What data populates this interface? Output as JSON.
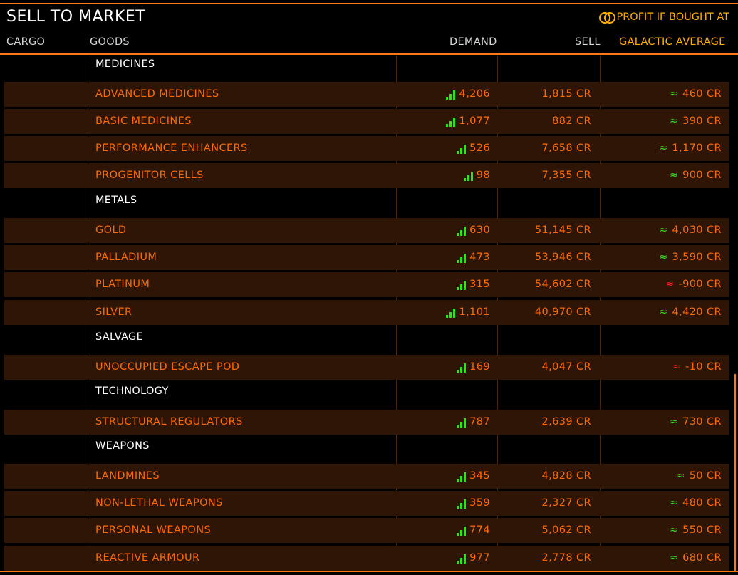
{
  "header": {
    "title": "SELL TO MARKET",
    "profit_note": "PROFIT IF BOUGHT AT",
    "profit_icon": "linked-rings-icon"
  },
  "columns": {
    "cargo": "CARGO",
    "goods": "GOODS",
    "demand": "DEMAND",
    "sell": "SELL",
    "galactic_average": "GALACTIC AVERAGE"
  },
  "colors": {
    "accent": "#ff7a14",
    "gold": "#ffae00",
    "row_bg": "#2e1505",
    "positive": "#32e61e",
    "negative": "#ff2020"
  },
  "categories": [
    {
      "name": "MEDICINES",
      "items": [
        {
          "name": "ADVANCED MEDICINES",
          "demand": "4,206",
          "sell": "1,815 CR",
          "profit": "460 CR",
          "profit_sign": "positive"
        },
        {
          "name": "BASIC MEDICINES",
          "demand": "1,077",
          "sell": "882 CR",
          "profit": "390 CR",
          "profit_sign": "positive"
        },
        {
          "name": "PERFORMANCE ENHANCERS",
          "demand": "526",
          "sell": "7,658 CR",
          "profit": "1,170 CR",
          "profit_sign": "positive"
        },
        {
          "name": "PROGENITOR CELLS",
          "demand": "98",
          "sell": "7,355 CR",
          "profit": "900 CR",
          "profit_sign": "positive"
        }
      ]
    },
    {
      "name": "METALS",
      "items": [
        {
          "name": "GOLD",
          "demand": "630",
          "sell": "51,145 CR",
          "profit": "4,030 CR",
          "profit_sign": "positive"
        },
        {
          "name": "PALLADIUM",
          "demand": "473",
          "sell": "53,946 CR",
          "profit": "3,590 CR",
          "profit_sign": "positive"
        },
        {
          "name": "PLATINUM",
          "demand": "315",
          "sell": "54,602 CR",
          "profit": "-900 CR",
          "profit_sign": "negative"
        },
        {
          "name": "SILVER",
          "demand": "1,101",
          "sell": "40,970 CR",
          "profit": "4,420 CR",
          "profit_sign": "positive"
        }
      ]
    },
    {
      "name": "SALVAGE",
      "items": [
        {
          "name": "UNOCCUPIED ESCAPE POD",
          "demand": "169",
          "sell": "4,047 CR",
          "profit": "-10 CR",
          "profit_sign": "negative"
        }
      ]
    },
    {
      "name": "TECHNOLOGY",
      "items": [
        {
          "name": "STRUCTURAL REGULATORS",
          "demand": "787",
          "sell": "2,639 CR",
          "profit": "730 CR",
          "profit_sign": "positive"
        }
      ]
    },
    {
      "name": "WEAPONS",
      "items": [
        {
          "name": "LANDMINES",
          "demand": "345",
          "sell": "4,828 CR",
          "profit": "50 CR",
          "profit_sign": "positive"
        },
        {
          "name": "NON-LETHAL WEAPONS",
          "demand": "359",
          "sell": "2,327 CR",
          "profit": "480 CR",
          "profit_sign": "positive"
        },
        {
          "name": "PERSONAL WEAPONS",
          "demand": "774",
          "sell": "5,062 CR",
          "profit": "550 CR",
          "profit_sign": "positive"
        },
        {
          "name": "REACTIVE ARMOUR",
          "demand": "977",
          "sell": "2,778 CR",
          "profit": "680 CR",
          "profit_sign": "positive"
        }
      ]
    }
  ],
  "symbols": {
    "approx": "≈"
  }
}
